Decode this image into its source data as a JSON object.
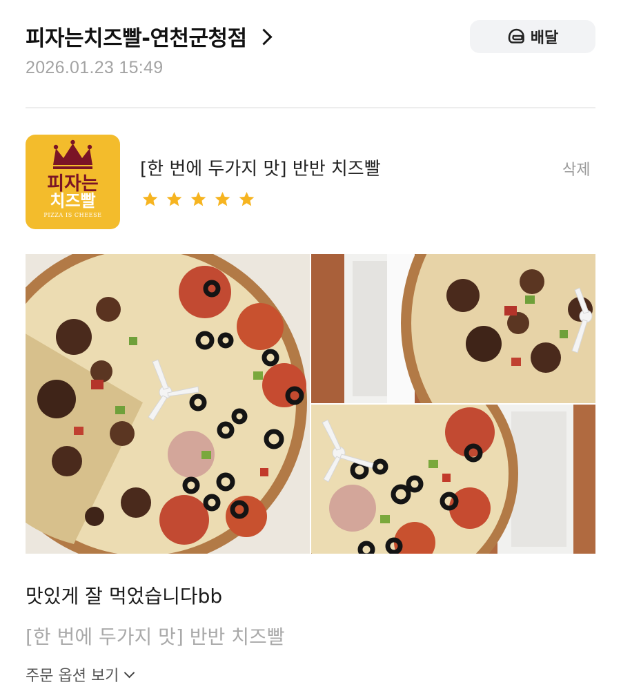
{
  "header": {
    "store_name": "피자는치즈빨-연천군청점",
    "order_datetime": "2026.01.23 15:49",
    "delivery_type": "배달",
    "delivery_icon": "helmet-icon"
  },
  "review": {
    "menu_title": "[한 번에 두가지 맛] 반반 치즈빨",
    "rating": 5,
    "rating_max": 5,
    "delete_label": "삭제",
    "body": "맛있게 잘 먹었습니다bb",
    "ordered_menu": "[한 번에 두가지 맛] 반반 치즈빨",
    "options_toggle": "주문 옵션 보기"
  },
  "logo": {
    "line1": "피자는",
    "line2": "치즈빨",
    "tagline": "PIZZA IS CHEESE"
  },
  "colors": {
    "star": "#f6b420",
    "logo_bg": "#f3bc2c",
    "logo_brand": "#7a1426"
  },
  "photos": [
    {
      "name": "review-photo-main"
    },
    {
      "name": "review-photo-top-right"
    },
    {
      "name": "review-photo-bottom-right"
    }
  ]
}
